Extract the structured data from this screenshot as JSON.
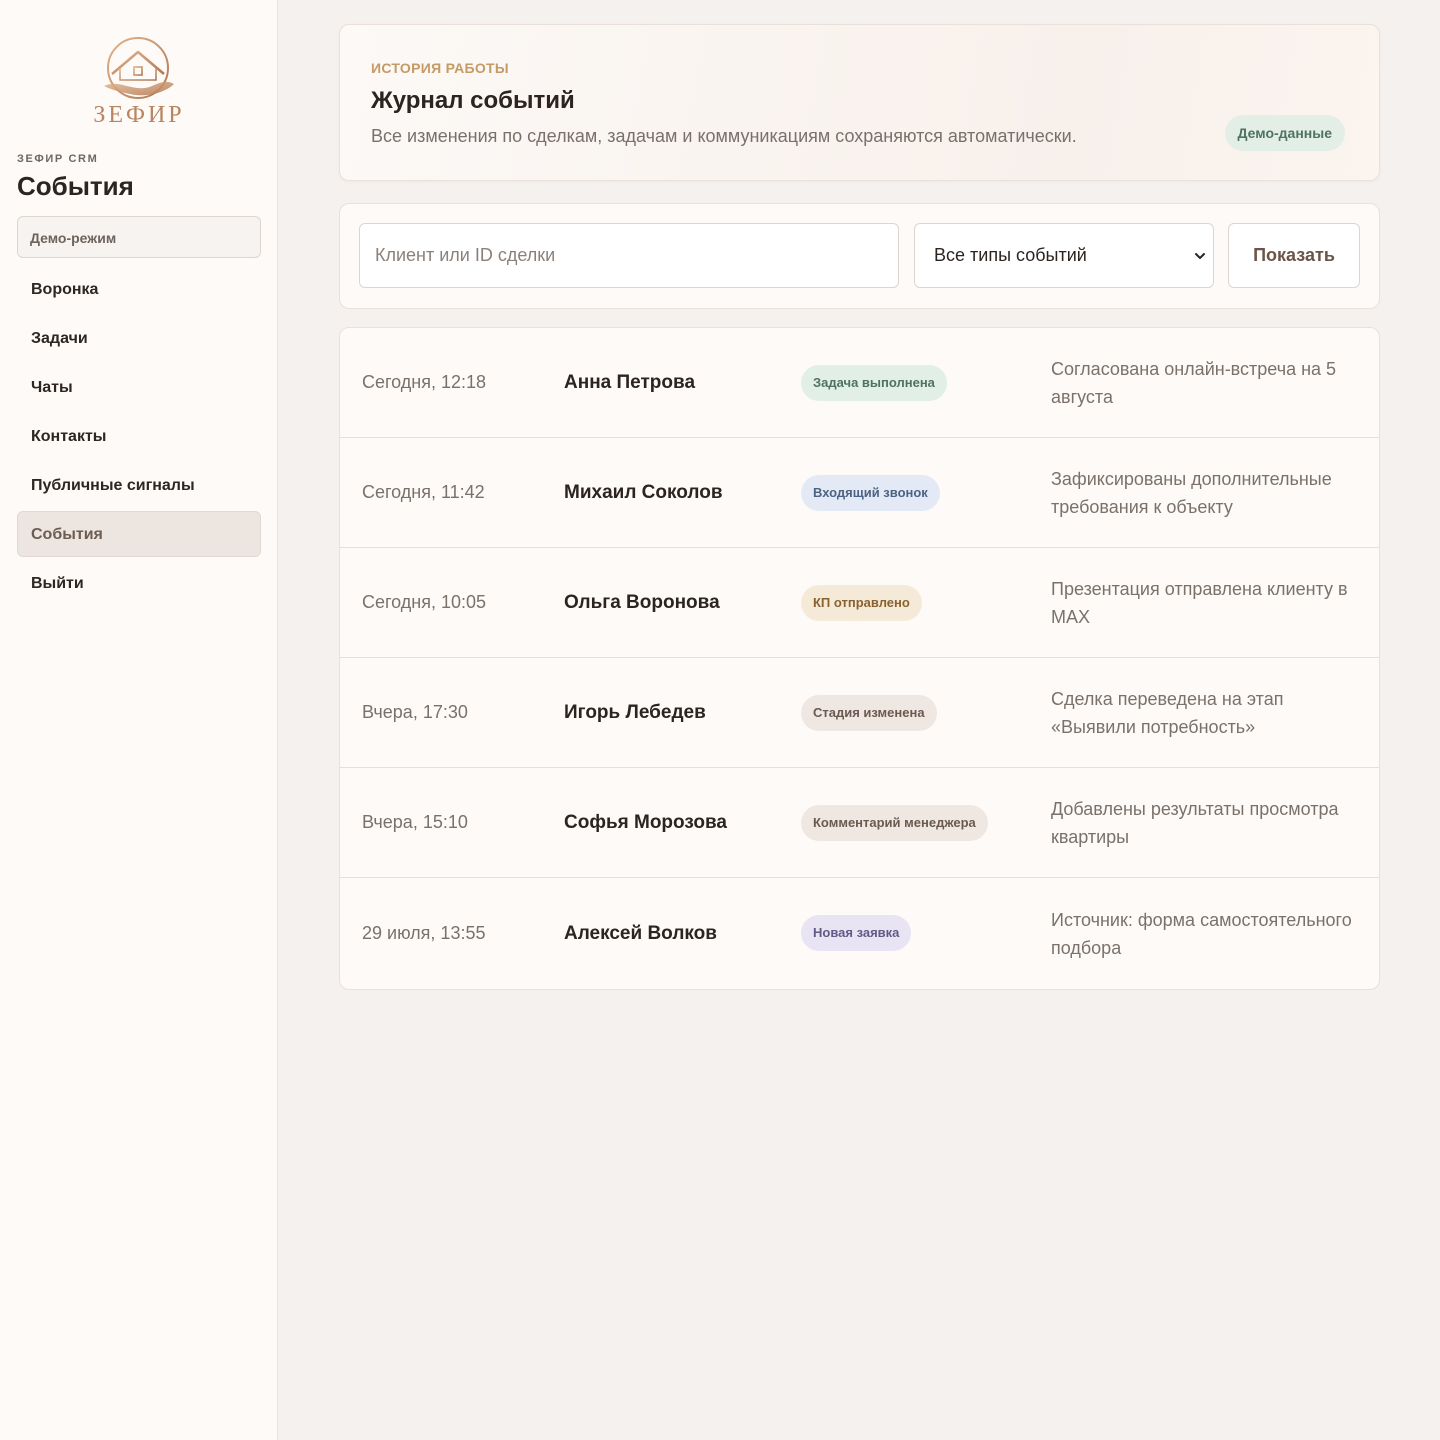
{
  "brand": {
    "logo_text": "ЗЕФИР",
    "subtitle": "ЗЕФИР CRM",
    "page_heading": "События",
    "demo_mode": "Демо-режим"
  },
  "nav": {
    "items": [
      {
        "label": "Воронка"
      },
      {
        "label": "Задачи"
      },
      {
        "label": "Чаты"
      },
      {
        "label": "Контакты"
      },
      {
        "label": "Публичные сигналы"
      },
      {
        "label": "События",
        "active": true
      },
      {
        "label": "Выйти"
      }
    ]
  },
  "hero": {
    "kicker": "ИСТОРИЯ РАБОТЫ",
    "title": "Журнал событий",
    "description": "Все изменения по сделкам, задачам и коммуникациям сохраняются автоматически.",
    "badge": "Демо-данные"
  },
  "filters": {
    "search_placeholder": "Клиент или ID сделки",
    "search_value": "",
    "type_selected": "Все типы событий",
    "show_button": "Показать"
  },
  "events": [
    {
      "time": "Сегодня, 12:18",
      "client": "Анна Петрова",
      "type": "Задача выполнена",
      "type_bg": "#e2efe6",
      "type_fg": "#4f7262",
      "description": "Согласована онлайн-встреча на 5 августа"
    },
    {
      "time": "Сегодня, 11:42",
      "client": "Михаил Соколов",
      "type": "Входящий звонок",
      "type_bg": "#e4eaf5",
      "type_fg": "#4d6384",
      "description": "Зафиксированы дополнительные требования к объекту"
    },
    {
      "time": "Сегодня, 10:05",
      "client": "Ольга Воронова",
      "type": "КП отправлено",
      "type_bg": "#f5ead7",
      "type_fg": "#8a6232",
      "description": "Презентация отправлена клиенту в MAX"
    },
    {
      "time": "Вчера, 17:30",
      "client": "Игорь Лебедев",
      "type": "Стадия изменена",
      "type_bg": "#efe7e2",
      "type_fg": "#6a5a50",
      "description": "Сделка переведена на этап «Выявили потребность»"
    },
    {
      "time": "Вчера, 15:10",
      "client": "Софья Морозова",
      "type": "Комментарий менеджера",
      "type_bg": "#efe7e2",
      "type_fg": "#6a5a50",
      "description": "Добавлены результаты просмотра квартиры"
    },
    {
      "time": "29 июля, 13:55",
      "client": "Алексей Волков",
      "type": "Новая заявка",
      "type_bg": "#e9e4f4",
      "type_fg": "#635a86",
      "description": "Источник: форма самостоятельного подбора"
    }
  ]
}
